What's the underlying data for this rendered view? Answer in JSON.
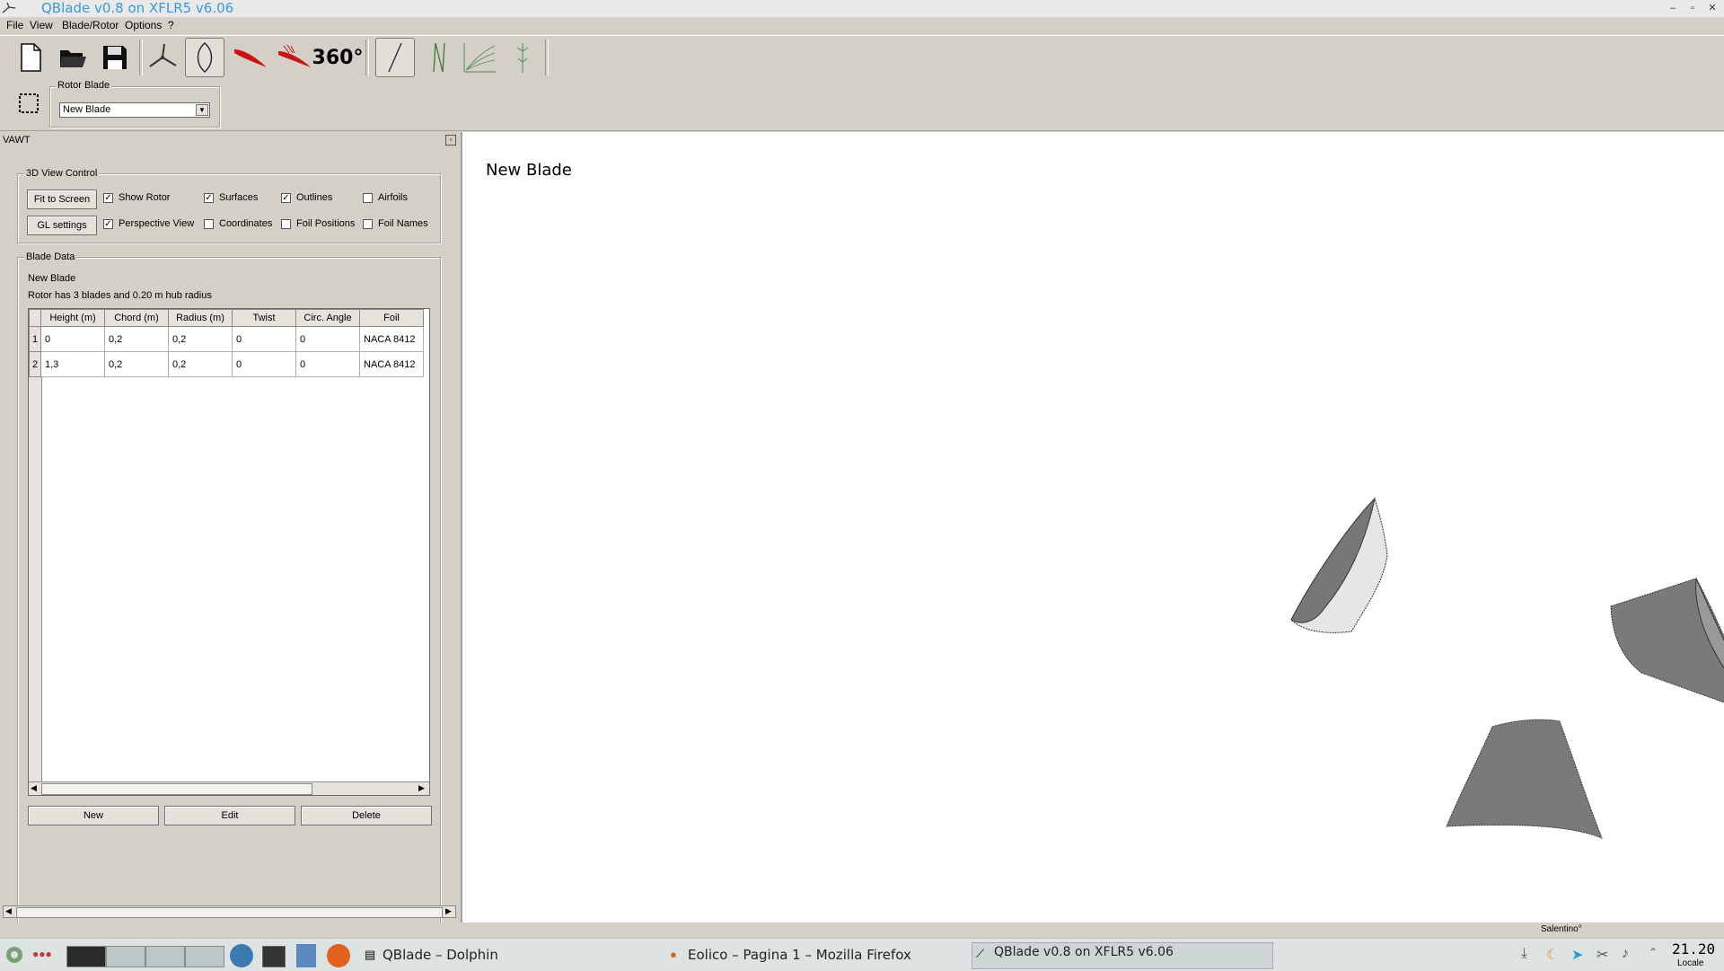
{
  "window": {
    "title": "QBlade  v0.8  on  XFLR5  v6.06",
    "controls": [
      "–",
      "▫",
      "✕"
    ]
  },
  "menu": [
    "File",
    "View",
    "Blade/Rotor",
    "Options",
    "?"
  ],
  "toolbar": {
    "tools": [
      "new-document",
      "open-folder",
      "save",
      "rotor-view",
      "blade-design",
      "airfoil",
      "airfoil-extrapolation",
      "360-polar",
      "line-tool",
      "blade-design-2",
      "simulation",
      "turbine"
    ],
    "polar_360_label": "360°"
  },
  "rotor_blade": {
    "group_label": "Rotor Blade",
    "selected": "New Blade"
  },
  "dock": {
    "title": "VAWT",
    "view_control": {
      "label": "3D View Control",
      "fit_button": "Fit to Screen",
      "gl_button": "GL settings",
      "checks": [
        {
          "label": "Show Rotor",
          "checked": true
        },
        {
          "label": "Surfaces",
          "checked": true
        },
        {
          "label": "Outlines",
          "checked": true
        },
        {
          "label": "Airfoils",
          "checked": false
        },
        {
          "label": "Perspective View",
          "checked": true
        },
        {
          "label": "Coordinates",
          "checked": false
        },
        {
          "label": "Foil Positions",
          "checked": false
        },
        {
          "label": "Foil Names",
          "checked": false
        }
      ]
    },
    "blade_data": {
      "label": "Blade Data",
      "name": "New Blade",
      "info": "Rotor has 3 blades and 0.20 m hub radius",
      "columns": [
        "Height (m)",
        "Chord (m)",
        "Radius (m)",
        "Twist",
        "Circ. Angle",
        "Foil"
      ],
      "rows": [
        {
          "num": "1",
          "cells": [
            "0",
            "0,2",
            "0,2",
            "0",
            "0",
            "NACA 8412"
          ]
        },
        {
          "num": "2",
          "cells": [
            "1,3",
            "0,2",
            "0,2",
            "0",
            "0",
            "NACA 8412"
          ]
        }
      ],
      "buttons": {
        "new": "New",
        "edit": "Edit",
        "delete": "Delete"
      }
    }
  },
  "viewport": {
    "title": "New Blade"
  },
  "status": {
    "keyboard": "Salentino°"
  },
  "taskbar": {
    "tasks": [
      "QBlade – Dolphin",
      "Eolico – Pagina 1 – Mozilla Firefox",
      "QBlade  v0.8  on  XFLR5  v6.06"
    ],
    "clock": "21.20",
    "clock_label": "Locale"
  }
}
